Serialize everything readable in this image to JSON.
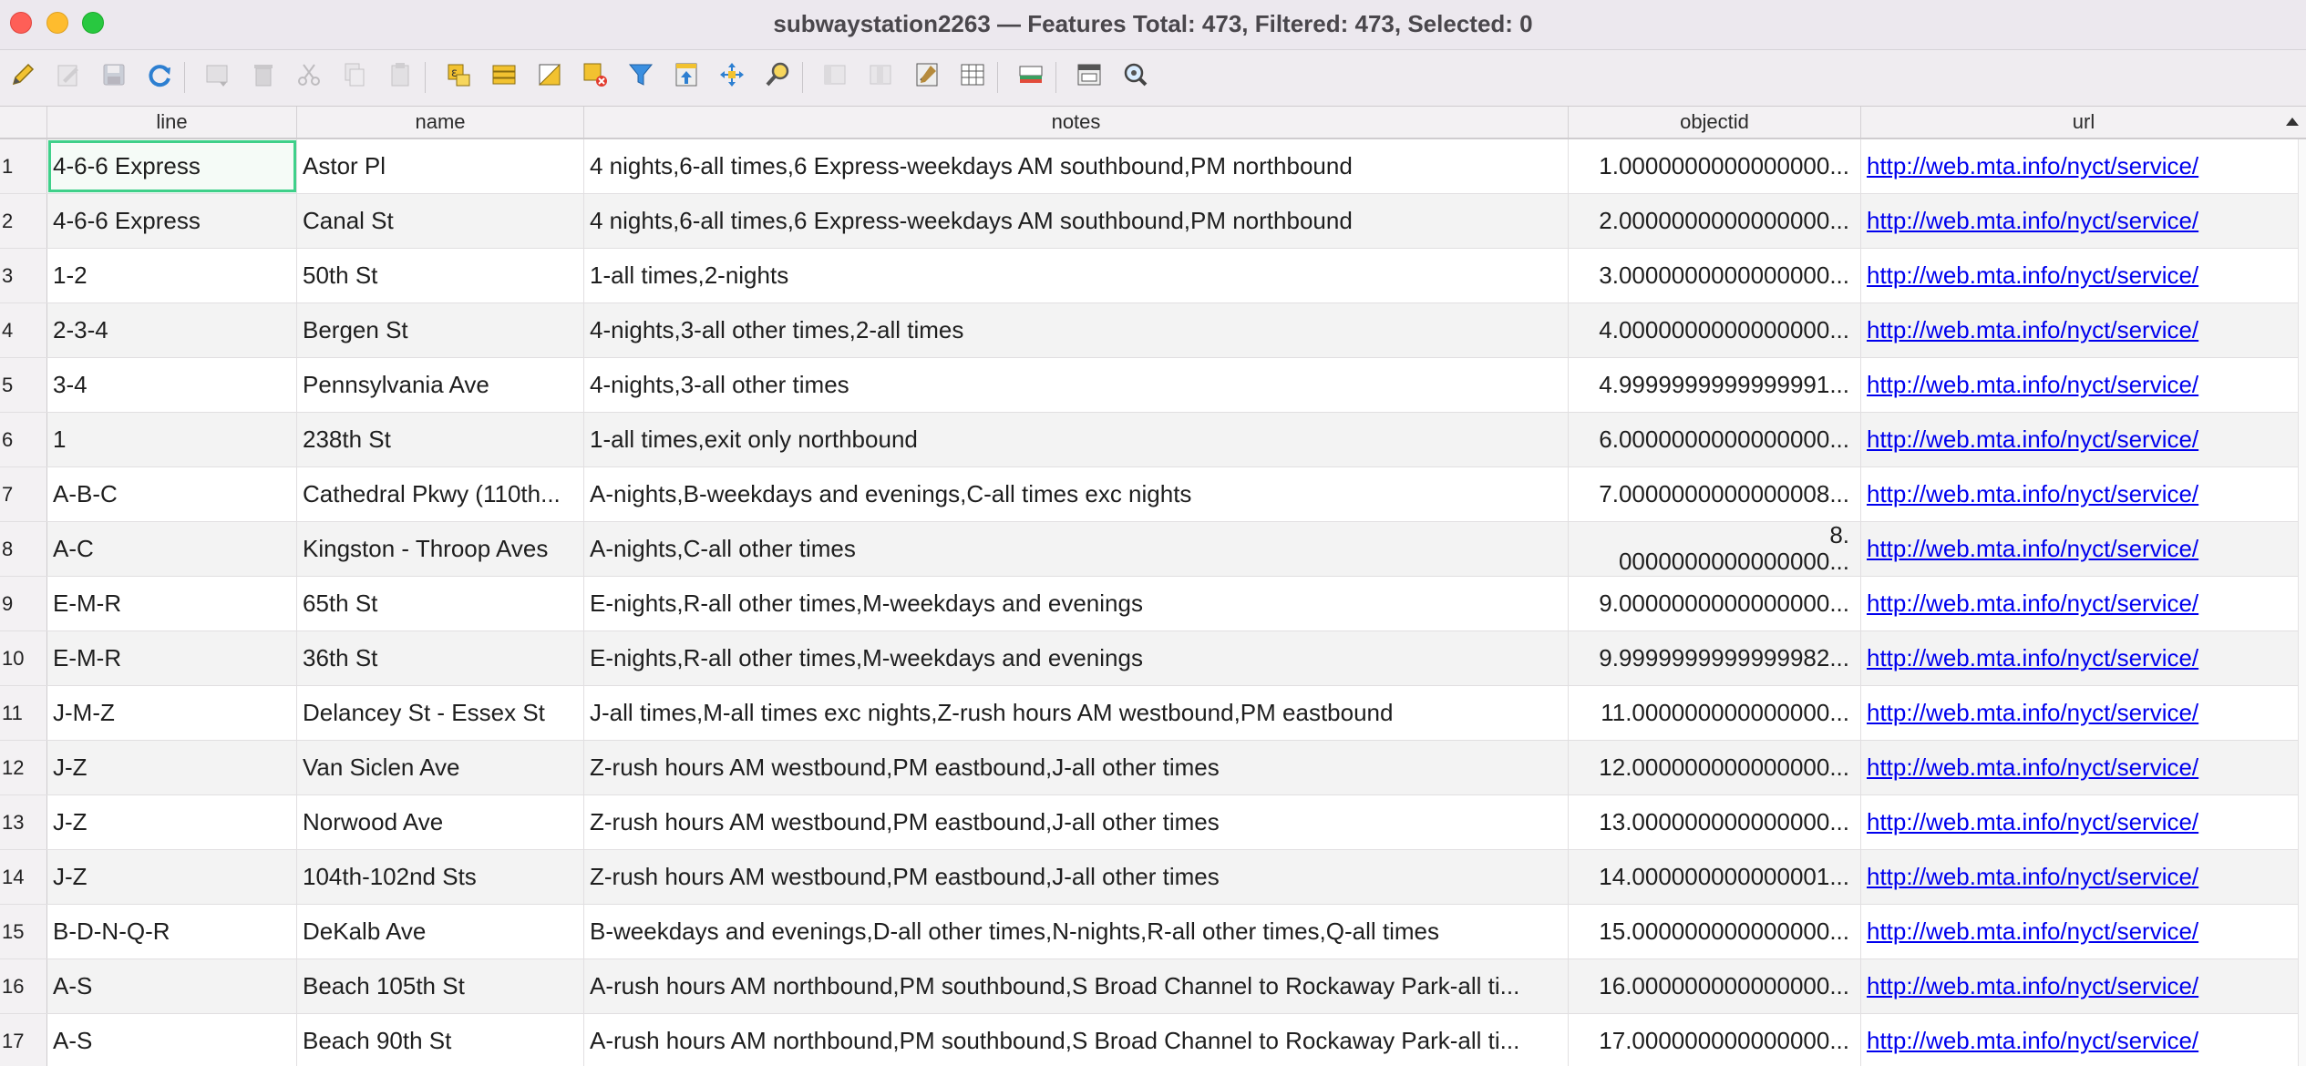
{
  "window": {
    "title": "subwaystation2263 — Features Total: 473, Filtered: 473, Selected: 0"
  },
  "toolbar": {
    "buttons": [
      {
        "icon": "pencil-icon",
        "name": "toggle-editing-button",
        "enabled": true
      },
      {
        "icon": "multi-edit-icon",
        "name": "multi-edit-button",
        "enabled": false
      },
      {
        "icon": "save-icon",
        "name": "save-edits-button",
        "enabled": false
      },
      {
        "icon": "reload-icon",
        "name": "reload-button",
        "enabled": true
      },
      {
        "icon": "add-feature-icon",
        "name": "add-feature-button",
        "enabled": false
      },
      {
        "icon": "delete-icon",
        "name": "delete-selected-button",
        "enabled": false
      },
      {
        "icon": "cut-icon",
        "name": "cut-button",
        "enabled": false
      },
      {
        "icon": "copy-icon",
        "name": "copy-button",
        "enabled": false
      },
      {
        "icon": "paste-icon",
        "name": "paste-button",
        "enabled": false
      },
      {
        "icon": "select-expression-icon",
        "name": "select-by-expression-button",
        "enabled": true
      },
      {
        "icon": "select-all-icon",
        "name": "select-all-button",
        "enabled": true
      },
      {
        "icon": "invert-selection-icon",
        "name": "invert-selection-button",
        "enabled": true
      },
      {
        "icon": "deselect-icon",
        "name": "deselect-all-button",
        "enabled": true
      },
      {
        "icon": "filter-icon",
        "name": "filter-select-button",
        "enabled": true
      },
      {
        "icon": "move-to-top-icon",
        "name": "move-selection-top-button",
        "enabled": true
      },
      {
        "icon": "pan-icon",
        "name": "pan-to-selected-button",
        "enabled": true
      },
      {
        "icon": "zoom-selected-icon",
        "name": "zoom-to-selected-button",
        "enabled": true
      },
      {
        "icon": "new-field-icon",
        "name": "new-field-button",
        "enabled": false
      },
      {
        "icon": "delete-field-icon",
        "name": "delete-field-button",
        "enabled": false
      },
      {
        "icon": "field-calculator-icon",
        "name": "field-calculator-button",
        "enabled": true
      },
      {
        "icon": "conditional-format-icon",
        "name": "conditional-formatting-button",
        "enabled": true
      },
      {
        "icon": "dock-icon",
        "name": "dock-table-button",
        "enabled": true
      },
      {
        "icon": "actions-icon",
        "name": "actions-button",
        "enabled": true
      },
      {
        "icon": "zoom-map-icon",
        "name": "zoom-map-button",
        "enabled": true
      }
    ]
  },
  "table": {
    "columns": [
      "line",
      "name",
      "notes",
      "objectid",
      "url"
    ],
    "rows": [
      {
        "n": "1",
        "line": "4-6-6 Express",
        "name": "Astor Pl",
        "notes": "4 nights,6-all times,6 Express-weekdays AM southbound,PM northbound",
        "objectid": "1.0000000000000000...",
        "url": "http://web.mta.info/nyct/service/"
      },
      {
        "n": "2",
        "line": "4-6-6 Express",
        "name": "Canal St",
        "notes": "4 nights,6-all times,6 Express-weekdays AM southbound,PM northbound",
        "objectid": "2.0000000000000000...",
        "url": "http://web.mta.info/nyct/service/"
      },
      {
        "n": "3",
        "line": "1-2",
        "name": "50th St",
        "notes": "1-all times,2-nights",
        "objectid": "3.0000000000000000...",
        "url": "http://web.mta.info/nyct/service/"
      },
      {
        "n": "4",
        "line": "2-3-4",
        "name": "Bergen St",
        "notes": "4-nights,3-all other times,2-all times",
        "objectid": "4.0000000000000000...",
        "url": "http://web.mta.info/nyct/service/"
      },
      {
        "n": "5",
        "line": "3-4",
        "name": "Pennsylvania Ave",
        "notes": "4-nights,3-all other times",
        "objectid": "4.9999999999999991...",
        "url": "http://web.mta.info/nyct/service/"
      },
      {
        "n": "6",
        "line": "1",
        "name": "238th St",
        "notes": "1-all times,exit only northbound",
        "objectid": "6.0000000000000000...",
        "url": "http://web.mta.info/nyct/service/"
      },
      {
        "n": "7",
        "line": "A-B-C",
        "name": "Cathedral Pkwy (110th...",
        "notes": "A-nights,B-weekdays and evenings,C-all times exc nights",
        "objectid": "7.0000000000000008...",
        "url": "http://web.mta.info/nyct/service/"
      },
      {
        "n": "8",
        "line": "A-C",
        "name": "Kingston - Throop Aves",
        "notes": "A-nights,C-all other times",
        "objectid_line1": "8.",
        "objectid": "0000000000000000...",
        "url": "http://web.mta.info/nyct/service/"
      },
      {
        "n": "9",
        "line": "E-M-R",
        "name": "65th St",
        "notes": "E-nights,R-all other times,M-weekdays and evenings",
        "objectid": "9.0000000000000000...",
        "url": "http://web.mta.info/nyct/service/"
      },
      {
        "n": "10",
        "line": "E-M-R",
        "name": "36th St",
        "notes": "E-nights,R-all other times,M-weekdays and evenings",
        "objectid": "9.9999999999999982...",
        "url": "http://web.mta.info/nyct/service/"
      },
      {
        "n": "11",
        "line": "J-M-Z",
        "name": "Delancey St - Essex St",
        "notes": "J-all times,M-all times exc nights,Z-rush hours AM westbound,PM eastbound",
        "objectid": "11.000000000000000...",
        "url": "http://web.mta.info/nyct/service/"
      },
      {
        "n": "12",
        "line": "J-Z",
        "name": "Van Siclen Ave",
        "notes": "Z-rush hours AM westbound,PM eastbound,J-all other times",
        "objectid": "12.000000000000000...",
        "url": "http://web.mta.info/nyct/service/"
      },
      {
        "n": "13",
        "line": "J-Z",
        "name": "Norwood Ave",
        "notes": "Z-rush hours AM westbound,PM eastbound,J-all other times",
        "objectid": "13.000000000000000...",
        "url": "http://web.mta.info/nyct/service/"
      },
      {
        "n": "14",
        "line": "J-Z",
        "name": "104th-102nd Sts",
        "notes": "Z-rush hours AM westbound,PM eastbound,J-all other times",
        "objectid": "14.000000000000001...",
        "url": "http://web.mta.info/nyct/service/"
      },
      {
        "n": "15",
        "line": "B-D-N-Q-R",
        "name": "DeKalb Ave",
        "notes": "B-weekdays and evenings,D-all other times,N-nights,R-all other times,Q-all times",
        "objectid": "15.000000000000000...",
        "url": "http://web.mta.info/nyct/service/"
      },
      {
        "n": "16",
        "line": "A-S",
        "name": "Beach 105th St",
        "notes": "A-rush hours AM northbound,PM southbound,S Broad Channel to Rockaway Park-all ti...",
        "objectid": "16.000000000000000...",
        "url": "http://web.mta.info/nyct/service/"
      },
      {
        "n": "17",
        "line": "A-S",
        "name": "Beach 90th St",
        "notes": "A-rush hours AM northbound,PM southbound,S Broad Channel to Rockaway Park-all ti...",
        "objectid": "17.000000000000000...",
        "url": "http://web.mta.info/nyct/service/"
      }
    ]
  },
  "colors": {
    "focus_outline": "#3fd08a",
    "link": "#0000ee",
    "row_alt": "#f3f3f3"
  }
}
